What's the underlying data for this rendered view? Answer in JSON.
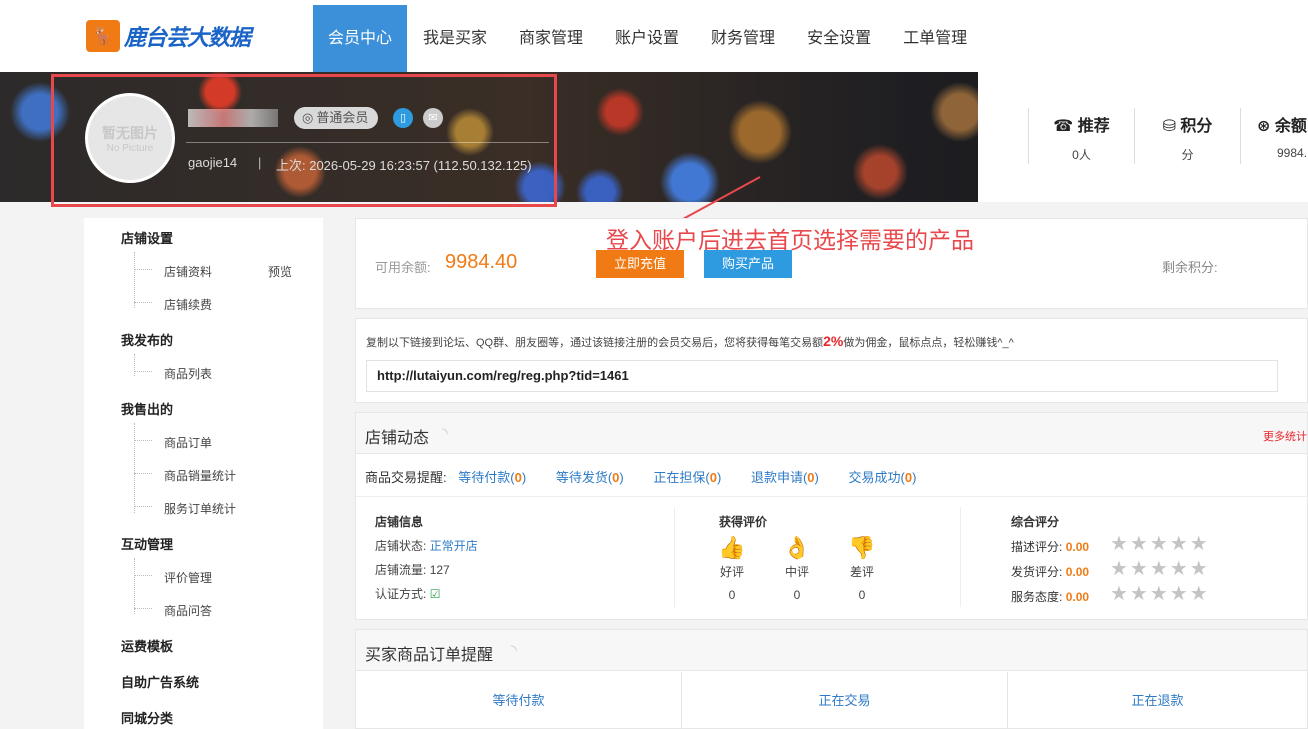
{
  "brand": {
    "logo_mark": "🦌",
    "name": "鹿台芸大数据"
  },
  "nav": [
    "会员中心",
    "我是买家",
    "商家管理",
    "账户设置",
    "财务管理",
    "安全设置",
    "工单管理"
  ],
  "profile": {
    "avatar_line1": "暂无图片",
    "avatar_line2": "No Picture",
    "member_badge": "普通会员",
    "user_id": "gaojie14",
    "separator": "|",
    "last_login": "上次: 2026-05-29 16:23:57 (112.50.132.125)"
  },
  "stats": [
    {
      "icon": "☎",
      "title": "推荐",
      "value": "0人"
    },
    {
      "icon": "⛁",
      "title": "积分",
      "value": "分"
    },
    {
      "icon": "⊛",
      "title": "余额",
      "value": "9984."
    }
  ],
  "sidebar": {
    "shop_settings": "店铺设置",
    "shop_profile": "店铺资料",
    "preview": "预览",
    "shop_renewal": "店铺续费",
    "my_published": "我发布的",
    "product_list": "商品列表",
    "my_sold": "我售出的",
    "product_orders": "商品订单",
    "sales_stats": "商品销量统计",
    "service_orders": "服务订单统计",
    "interaction": "互动管理",
    "review_mgmt": "评价管理",
    "product_qa": "商品问答",
    "shipping_template": "运费模板",
    "ad_system": "自助广告系统",
    "city_category": "同城分类"
  },
  "balance": {
    "annotation": "登入账户后进去首页选择需要的产品",
    "label": "可用余额:",
    "value": "9984.40",
    "recharge_btn": "立即充值",
    "buy_btn": "购买产品",
    "remaining_points": "剩余积分:"
  },
  "referral": {
    "desc_before": "复制以下链接到论坛、QQ群、朋友圈等，通过该链接注册的会员交易后，您将获得每笔交易额",
    "pct": "2%",
    "desc_after": "做为佣金，鼠标点点，轻松赚钱^_^",
    "link": "http://lutaiyun.com/reg/reg.php?tid=1461"
  },
  "dynamics": {
    "title": "店铺动态",
    "more": "更多统计",
    "trade_label": "商品交易提醒:",
    "trades": [
      {
        "label": "等待付款",
        "count": "0"
      },
      {
        "label": "等待发货",
        "count": "0"
      },
      {
        "label": "正在担保",
        "count": "0"
      },
      {
        "label": "退款申请",
        "count": "0"
      },
      {
        "label": "交易成功",
        "count": "0"
      }
    ],
    "shop_info_title": "店铺信息",
    "shop_status_label": "店铺状态:",
    "shop_status": "正常开店",
    "shop_traffic_label": "店铺流量:",
    "shop_traffic": "127",
    "verify_label": "认证方式:",
    "reviews_title": "获得评价",
    "reviews": [
      {
        "label": "好评",
        "count": "0",
        "icon": "👍"
      },
      {
        "label": "中评",
        "count": "0",
        "icon": "👌"
      },
      {
        "label": "差评",
        "count": "0",
        "icon": "👎"
      }
    ],
    "score_title": "综合评分",
    "scores": [
      {
        "label": "描述评分:",
        "value": "0.00"
      },
      {
        "label": "发货评分:",
        "value": "0.00"
      },
      {
        "label": "服务态度:",
        "value": "0.00"
      }
    ],
    "stars": "★★★★★"
  },
  "orders": {
    "title": "买家商品订单提醒",
    "cells": [
      "等待付款",
      "正在交易",
      "正在退款"
    ]
  },
  "colors": {
    "accent": "#3c8fd9",
    "orange": "#f07b14",
    "blue": "#2e9be0",
    "red": "#e8484c"
  }
}
